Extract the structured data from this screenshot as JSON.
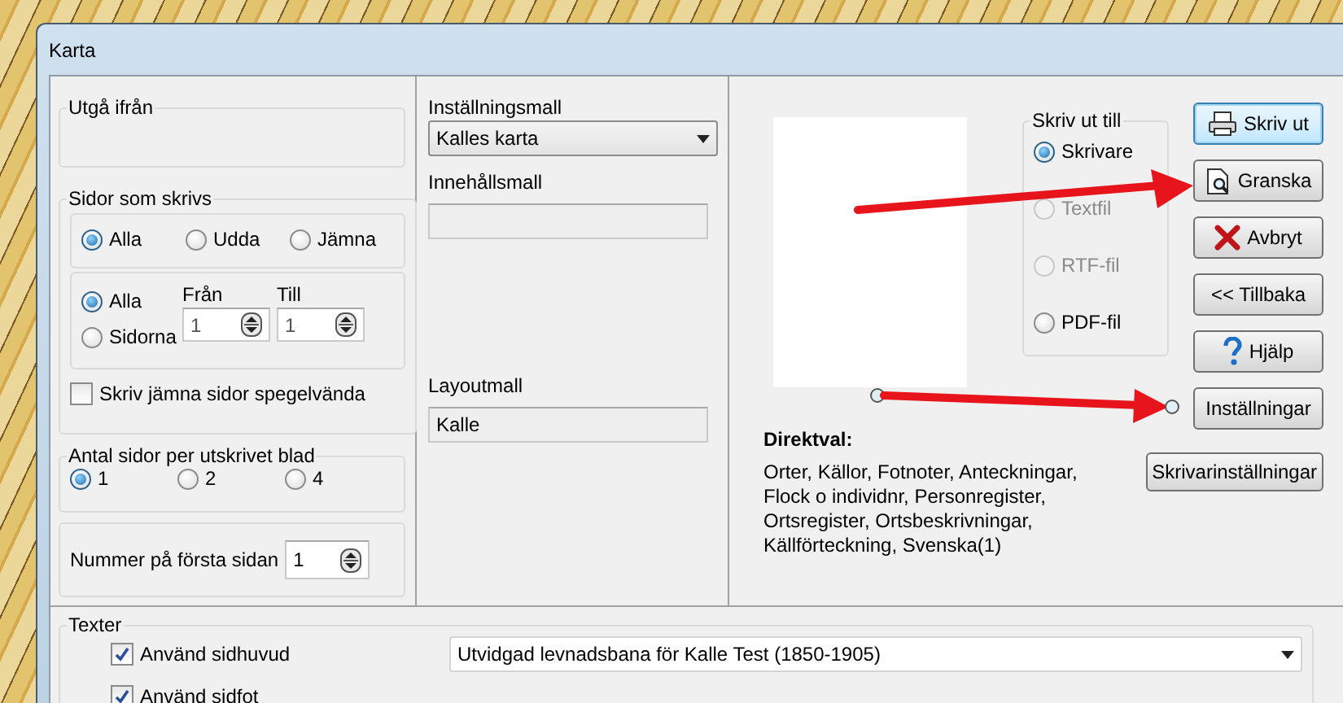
{
  "window": {
    "title": "Karta"
  },
  "start_from": {
    "label": "Utgå ifrån"
  },
  "pages": {
    "label": "Sidor som skrivs",
    "parity": [
      {
        "label": "Alla",
        "selected": true
      },
      {
        "label": "Udda",
        "selected": false
      },
      {
        "label": "Jämna",
        "selected": false
      }
    ],
    "range": [
      {
        "label": "Alla",
        "selected": true
      },
      {
        "label": "Sidorna",
        "selected": false
      }
    ],
    "from": {
      "label": "Från",
      "value": "1"
    },
    "to": {
      "label": "Till",
      "value": "1"
    },
    "mirror": {
      "label": "Skriv jämna sidor spegelvända",
      "checked": false
    }
  },
  "per_sheet": {
    "label": "Antal sidor per utskrivet blad",
    "options": [
      {
        "label": "1",
        "selected": true
      },
      {
        "label": "2",
        "selected": false
      },
      {
        "label": "4",
        "selected": false
      }
    ]
  },
  "first_page_number": {
    "label": "Nummer på första sidan",
    "value": "1"
  },
  "settings_template": {
    "label": "Inställningsmall",
    "value": "Kalles karta"
  },
  "content_template": {
    "label": "Innehållsmall"
  },
  "layout_template": {
    "label": "Layoutmall",
    "value": "Kalle"
  },
  "print_to": {
    "label": "Skriv ut till",
    "options": [
      {
        "label": "Skrivare",
        "selected": true,
        "disabled": false
      },
      {
        "label": "Textfil",
        "selected": false,
        "disabled": true
      },
      {
        "label": "RTF-fil",
        "selected": false,
        "disabled": true
      },
      {
        "label": "PDF-fil",
        "selected": false,
        "disabled": false
      }
    ]
  },
  "buttons": [
    {
      "label": "Skriv ut",
      "kind": "print",
      "default": true
    },
    {
      "label": "Granska",
      "kind": "preview",
      "default": false
    },
    {
      "label": "Avbryt",
      "kind": "cancel",
      "default": false
    },
    {
      "label": "<< Tillbaka",
      "kind": "plain",
      "default": false
    },
    {
      "label": "Hjälp",
      "kind": "help",
      "default": false
    },
    {
      "label": "Inställningar",
      "kind": "plain",
      "default": false
    }
  ],
  "printer_settings_button": {
    "label": "Skrivarinställningar"
  },
  "direct_selection": {
    "title": "Direktval:",
    "text": "Orter, Källor, Fotnoter, Anteckningar, Flock o individnr, Personregister, Ortsregister, Ortsbeskrivningar, Källförteckning, Svenska(1)"
  },
  "texts": {
    "label": "Texter",
    "rows": [
      {
        "label": "Använd sidhuvud",
        "checked": true,
        "value": "Utvidgad levnadsbana för Kalle Test (1850-1905)"
      },
      {
        "label": "Använd sidfot",
        "checked": true
      }
    ]
  }
}
